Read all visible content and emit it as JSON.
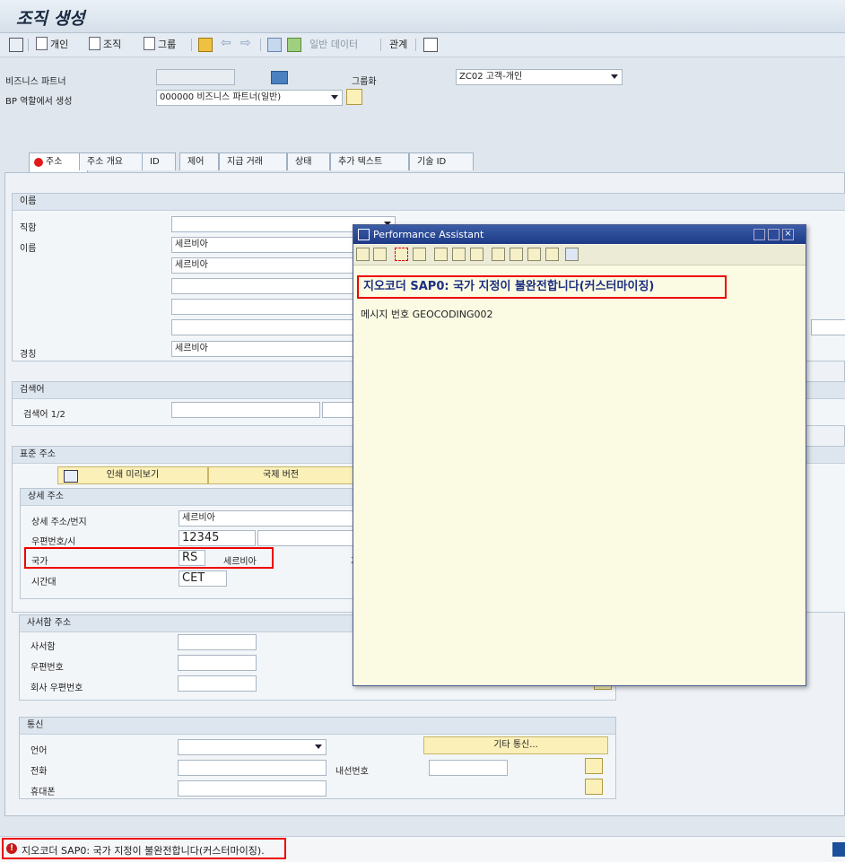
{
  "window": {
    "title": "조직 생성"
  },
  "toolbar": {
    "person": "개인",
    "org": "조직",
    "group": "그룹",
    "general_data": "일반 데이터",
    "relations": "관계"
  },
  "header": {
    "bp_label": "비즈니스 파트너",
    "grouping_label": "그룹화",
    "grouping_value": "ZC02 고객-개인",
    "role_label": "BP 역할에서 생성",
    "role_value": "000000 비즈니스 파트너(일반)"
  },
  "tabs": [
    "주소",
    "주소 개요",
    "ID",
    "제어",
    "지급 거래",
    "상태",
    "추가 텍스트",
    "기술 ID"
  ],
  "name_group": {
    "title": "이름",
    "salutation_label": "직함",
    "name_label": "이름",
    "name1": "세르비아",
    "name2": "세르비아",
    "title_label": "경칭",
    "title_value": "세르비아"
  },
  "search_group": {
    "title": "검색어",
    "label": "검색어 1/2"
  },
  "std_address": {
    "title": "표준 주소",
    "print_preview": "인쇄 미리보기",
    "intl_version": "국제 버전",
    "detail_title": "상세 주소",
    "street_label": "상세 주소/번지",
    "street_value": "세르비아",
    "postal_city_label": "우편번호/시",
    "postal_value": "12345",
    "country_label": "국가",
    "country_code": "RS",
    "country_name": "세르비아",
    "region_label": "지",
    "timezone_label": "시간대",
    "timezone_value": "CET"
  },
  "pobox": {
    "title": "사서함 주소",
    "pobox_label": "사서함",
    "postal_label": "우편번호",
    "company_postal_label": "회사 우편번호"
  },
  "comm": {
    "title": "통신",
    "language_label": "언어",
    "phone_label": "전화",
    "extension_label": "내선번호",
    "mobile_label": "휴대폰",
    "other_comm": "기타 통신..."
  },
  "popup": {
    "title": "Performance Assistant",
    "heading": "지오코더 SAP0: 국가 지정이 불완전합니다(커스터마이징)",
    "message_no": "메시지 번호 GEOCODING002"
  },
  "status": {
    "message": "지오코더 SAP0: 국가 지정이 불완전합니다(커스터마이징)."
  },
  "colors": {
    "accent": "#1d3a86",
    "error": "#e00000",
    "button": "#fbf0b8"
  }
}
